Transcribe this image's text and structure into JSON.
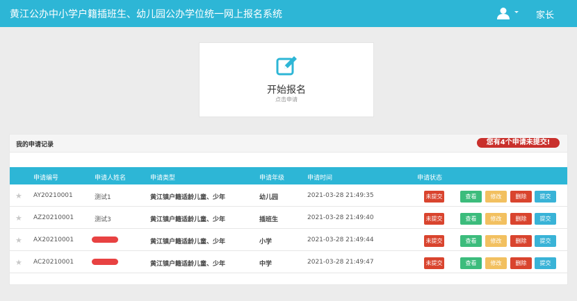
{
  "header": {
    "title": "黄江公办中小学户籍插班生、幼儿园公办学位统一网上报名系统",
    "role_label": "家长"
  },
  "start": {
    "label": "开始报名",
    "hint": "点击申请"
  },
  "records": {
    "title": "我的申请记录",
    "notice": "您有4个申请未提交!",
    "columns": [
      "申请编号",
      "申请人姓名",
      "申请类型",
      "申请年级",
      "申请时间",
      "申请状态"
    ],
    "rows": [
      {
        "id": "AY20210001",
        "name": "测试1",
        "type": "黄江镇户籍适龄儿童、少年",
        "grade": "幼儿园",
        "time": "2021-03-28 21:49:35",
        "status": "未提交",
        "redacted": false
      },
      {
        "id": "AZ20210001",
        "name": "测试3",
        "type": "黄江镇户籍适龄儿童、少年",
        "grade": "插班生",
        "time": "2021-03-28 21:49:40",
        "status": "未提交",
        "redacted": false
      },
      {
        "id": "AX20210001",
        "name": "",
        "type": "黄江镇户籍适龄儿童、少年",
        "grade": "小学",
        "time": "2021-03-28 21:49:44",
        "status": "未提交",
        "redacted": true
      },
      {
        "id": "AC20210001",
        "name": "",
        "type": "黄江镇户籍适龄儿童、少年",
        "grade": "中学",
        "time": "2021-03-28 21:49:47",
        "status": "未提交",
        "redacted": true
      }
    ],
    "actions": {
      "view": "查看",
      "edit": "修改",
      "delete": "删除",
      "submit": "提交"
    }
  },
  "colors": {
    "accent": "#2db6d6",
    "danger": "#d9442e",
    "success": "#3cbc7c",
    "warning": "#f2c060",
    "info": "#39b3d7"
  },
  "icons": {
    "user": "user-icon",
    "start": "edit-square-icon",
    "star": "star-icon"
  }
}
